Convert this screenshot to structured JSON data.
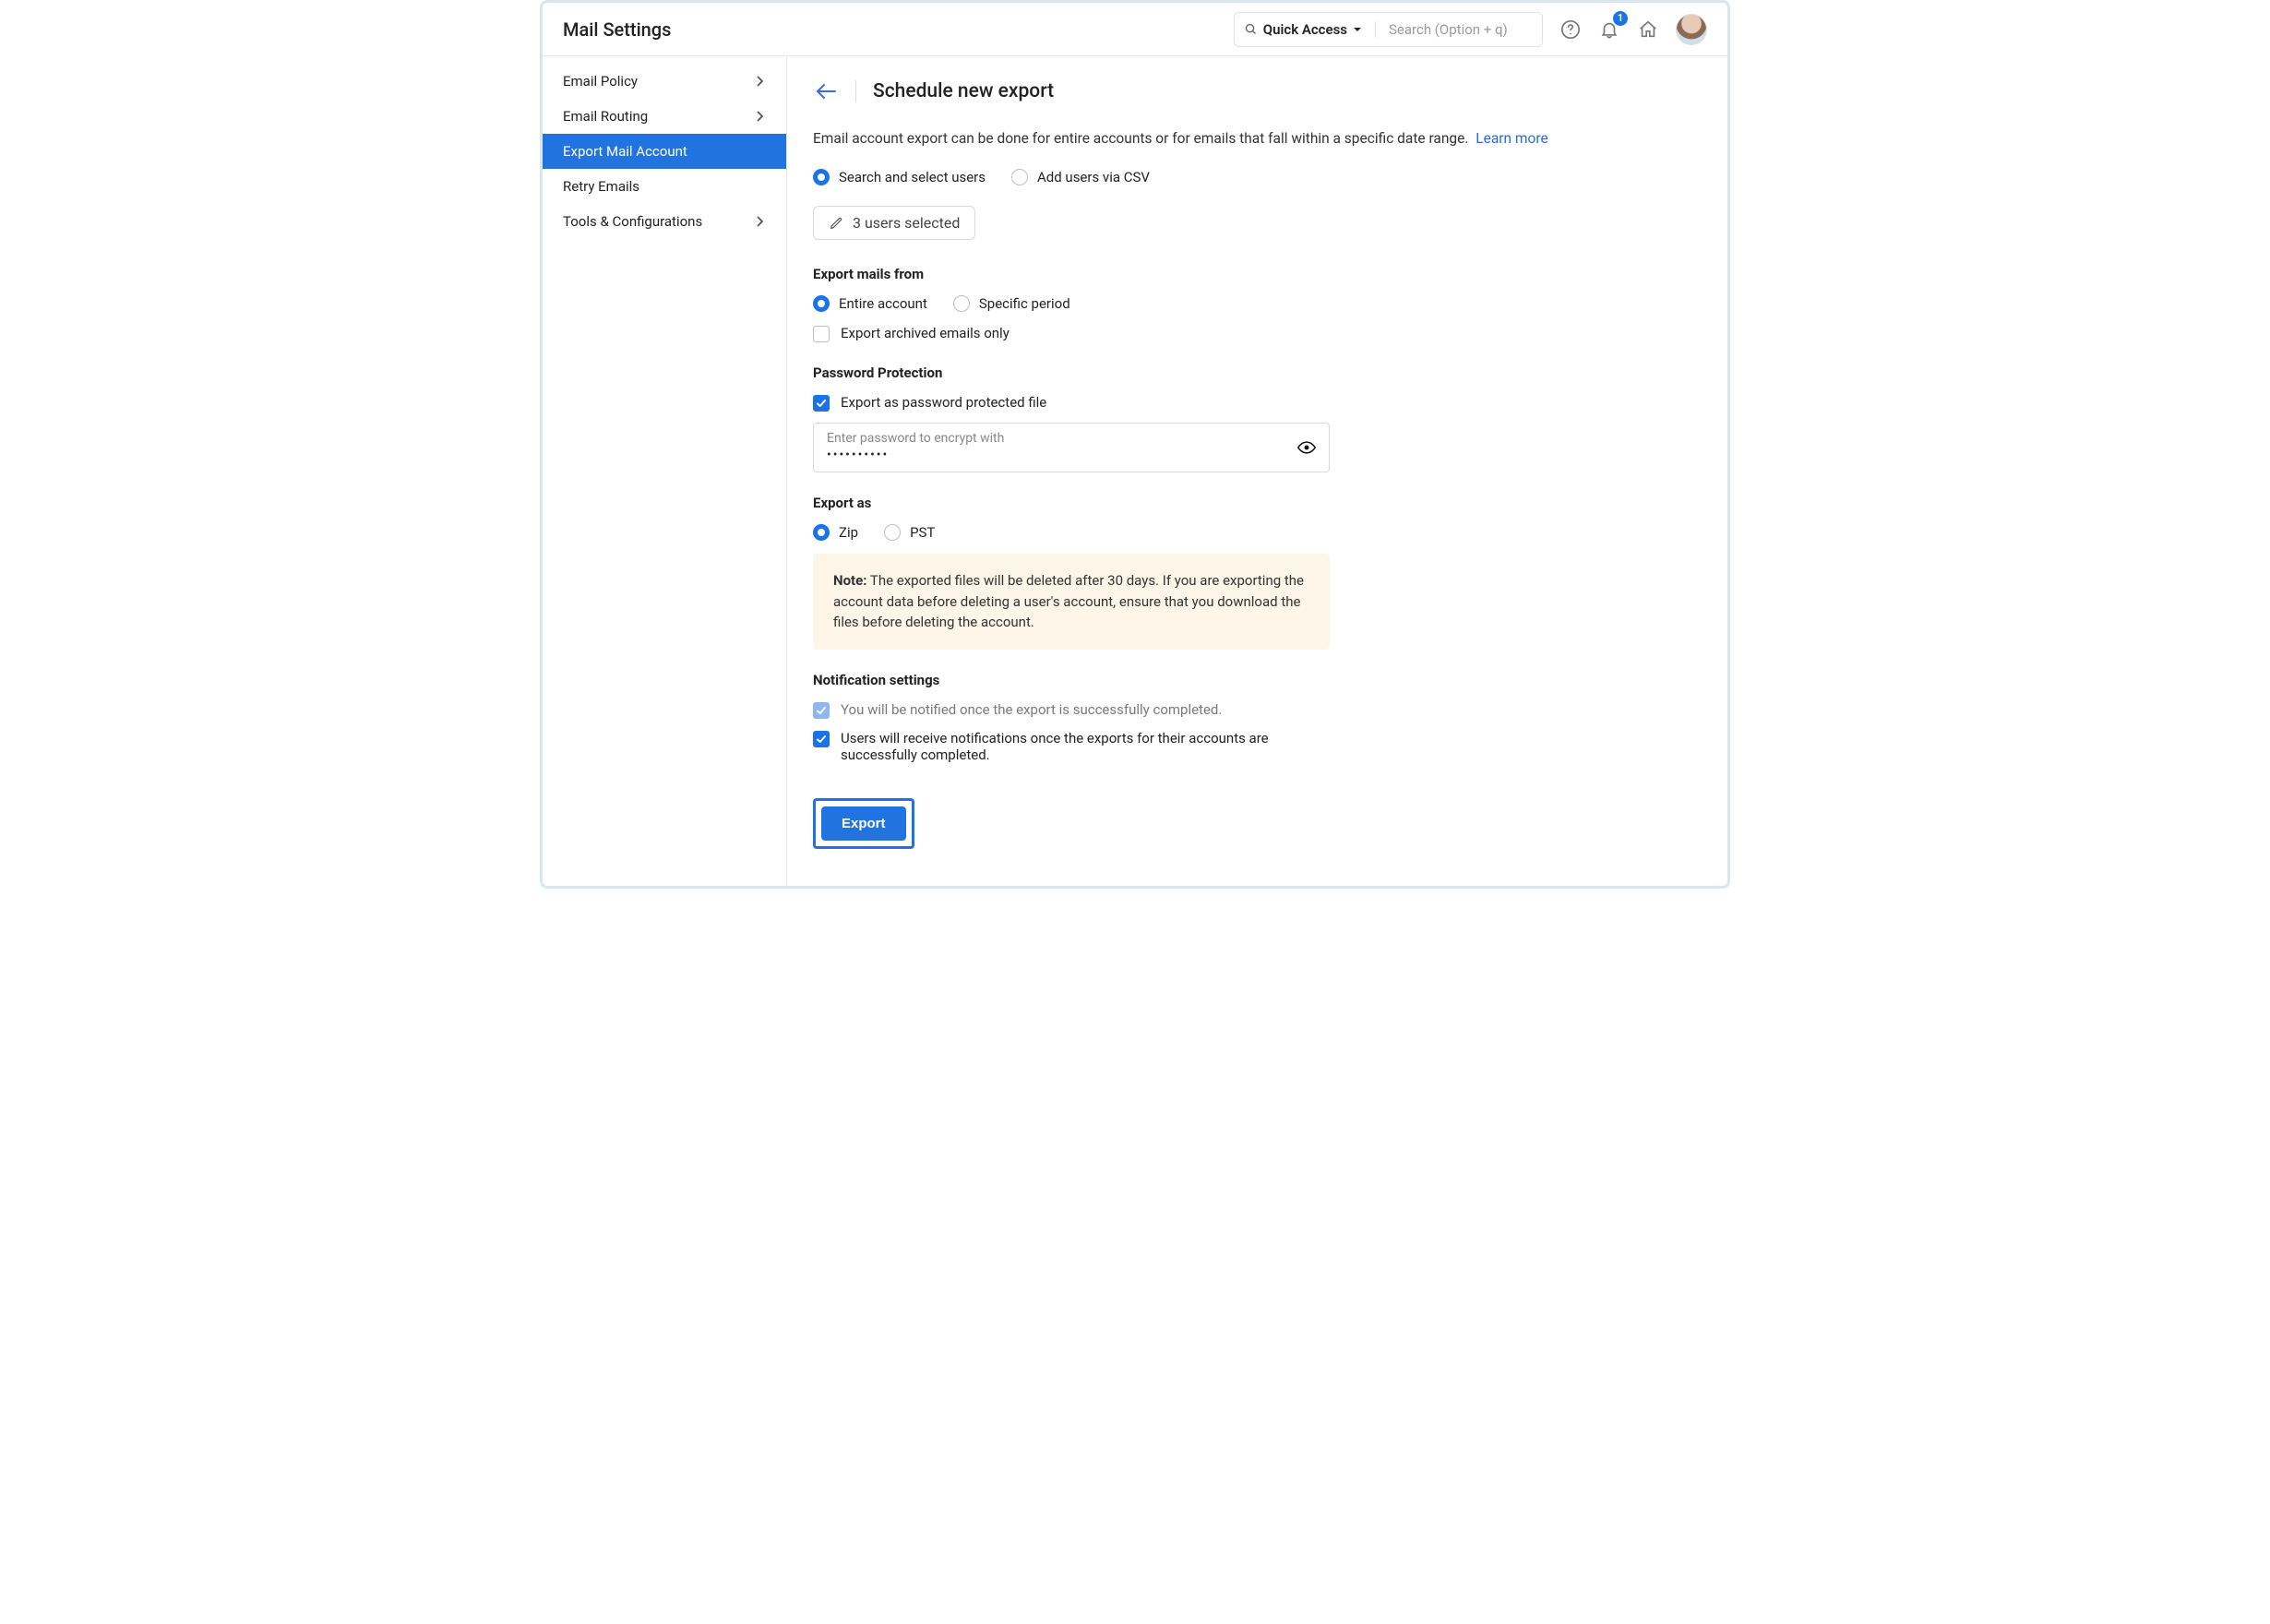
{
  "header": {
    "title": "Mail Settings",
    "quick_access_label": "Quick Access",
    "search_placeholder": "Search (Option + q)",
    "notification_count": "1"
  },
  "sidebar": {
    "items": [
      {
        "label": "Email Policy",
        "has_children": true,
        "active": false
      },
      {
        "label": "Email Routing",
        "has_children": true,
        "active": false
      },
      {
        "label": "Export Mail Account",
        "has_children": false,
        "active": true
      },
      {
        "label": "Retry Emails",
        "has_children": false,
        "active": false
      },
      {
        "label": "Tools & Configurations",
        "has_children": true,
        "active": false
      }
    ]
  },
  "page": {
    "title": "Schedule new export",
    "intro": "Email account export can be done for entire accounts or for emails that fall within a specific date range.",
    "learn_more": "Learn more",
    "user_mode": {
      "search_label": "Search and select users",
      "csv_label": "Add users via CSV",
      "selected_count_label": "3 users selected"
    },
    "export_from": {
      "heading": "Export mails from",
      "entire_label": "Entire account",
      "period_label": "Specific period",
      "archived_label": "Export archived emails only"
    },
    "password": {
      "heading": "Password Protection",
      "protect_label": "Export as password protected file",
      "placeholder": "Enter password to encrypt with",
      "value_masked": "••••••••••"
    },
    "export_as": {
      "heading": "Export as",
      "zip_label": "Zip",
      "pst_label": "PST"
    },
    "note": {
      "prefix": "Note:",
      "text": "The exported files will be deleted after 30 days. If you are exporting the account data before deleting a user's account, ensure that you download the files before deleting the account."
    },
    "notifications": {
      "heading": "Notification settings",
      "self_label": "You will be notified once the export is successfully completed.",
      "users_label": "Users will receive notifications once the exports for their accounts are successfully completed."
    },
    "export_button": "Export"
  }
}
